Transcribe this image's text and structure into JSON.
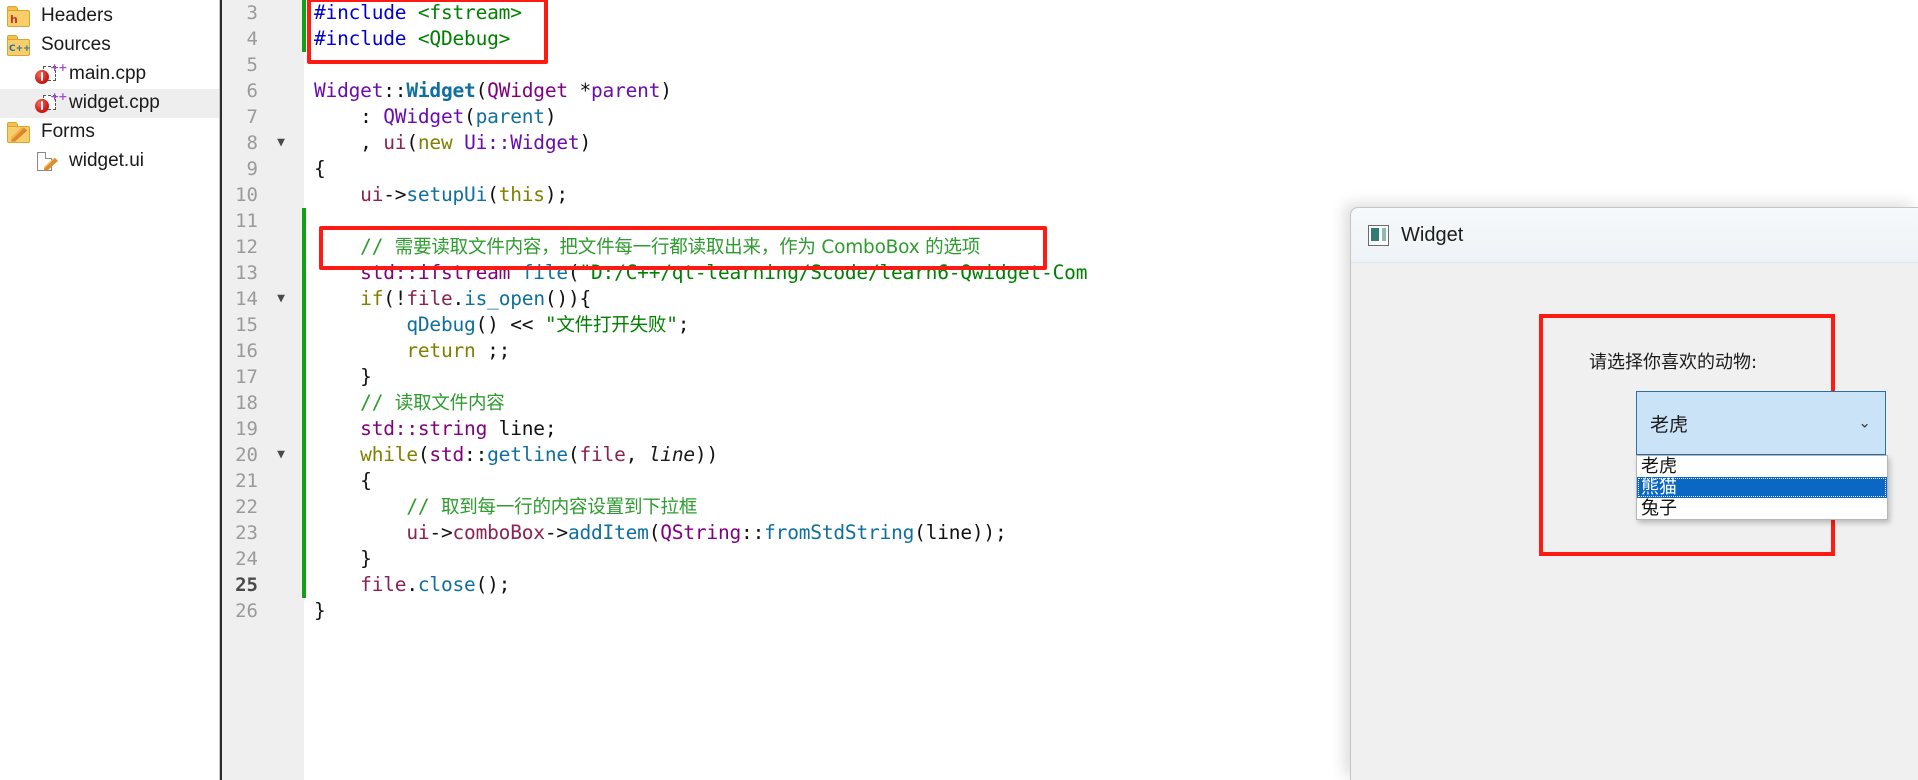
{
  "sidebar": {
    "items": [
      {
        "label": "Headers",
        "icon": "folder-h-icon",
        "indent": 0,
        "selected": false
      },
      {
        "label": "Sources",
        "icon": "folder-cpp-icon",
        "indent": 0,
        "selected": false
      },
      {
        "label": "main.cpp",
        "icon": "cpp-file-icon",
        "indent": 1,
        "selected": false
      },
      {
        "label": "widget.cpp",
        "icon": "cpp-file-icon",
        "indent": 1,
        "selected": true
      },
      {
        "label": "Forms",
        "icon": "folder-form-icon",
        "indent": 0,
        "selected": false
      },
      {
        "label": "widget.ui",
        "icon": "ui-file-icon",
        "indent": 1,
        "selected": false
      }
    ]
  },
  "editor": {
    "first_line": 3,
    "current_line": 25,
    "fold_markers": [
      8,
      14,
      20
    ],
    "change_bars": [
      {
        "from": 3,
        "to": 4
      },
      {
        "from": 11,
        "to": 25
      }
    ],
    "lines": [
      {
        "n": 3,
        "text": "#include <fstream>"
      },
      {
        "n": 4,
        "text": "#include <QDebug>"
      },
      {
        "n": 5,
        "text": ""
      },
      {
        "n": 6,
        "text": "Widget::Widget(QWidget *parent)"
      },
      {
        "n": 7,
        "text": "    : QWidget(parent)"
      },
      {
        "n": 8,
        "text": "    , ui(new Ui::Widget)"
      },
      {
        "n": 9,
        "text": "{"
      },
      {
        "n": 10,
        "text": "    ui->setupUi(this);"
      },
      {
        "n": 11,
        "text": ""
      },
      {
        "n": 12,
        "text": "    // 需要读取文件内容，把文件每一行都读取出来，作为 ComboBox 的选项"
      },
      {
        "n": 13,
        "text": "    std::ifstream file(\"D:/C++/qt-learning/Scode/learn6-Qwidget-Com"
      },
      {
        "n": 14,
        "text": "    if(!file.is_open()){"
      },
      {
        "n": 15,
        "text": "        qDebug() << \"文件打开失败\";"
      },
      {
        "n": 16,
        "text": "        return ;;"
      },
      {
        "n": 17,
        "text": "    }"
      },
      {
        "n": 18,
        "text": "    // 读取文件内容"
      },
      {
        "n": 19,
        "text": "    std::string line;"
      },
      {
        "n": 20,
        "text": "    while(std::getline(file, line))"
      },
      {
        "n": 21,
        "text": "    {"
      },
      {
        "n": 22,
        "text": "        // 取到每一行的内容设置到下拉框"
      },
      {
        "n": 23,
        "text": "        ui->comboBox->addItem(QString::fromStdString(line));"
      },
      {
        "n": 24,
        "text": "    }"
      },
      {
        "n": 25,
        "text": "    file.close();"
      },
      {
        "n": 26,
        "text": "}"
      }
    ],
    "highlight_boxes": [
      {
        "name": "include-block-highlight",
        "lines": "3-4"
      },
      {
        "name": "comment-line-highlight",
        "lines": "12"
      }
    ]
  },
  "qt_window": {
    "title": "Widget",
    "app_icon": "widget-app-icon",
    "group_highlight": "animal-selection-highlight",
    "label": "请选择你喜欢的动物:",
    "combo": {
      "selected": "老虎",
      "arrow_icon": "chevron-down-icon",
      "options": [
        {
          "text": "老虎",
          "highlighted": false
        },
        {
          "text": "熊猫",
          "highlighted": true
        },
        {
          "text": "兔子",
          "highlighted": false
        }
      ]
    }
  },
  "colors": {
    "annotation_red": "#ff1a14",
    "change_bar_green": "#14a014",
    "combo_field_blue": "#cbe3f7",
    "combo_selected_blue": "#0a68c4"
  }
}
